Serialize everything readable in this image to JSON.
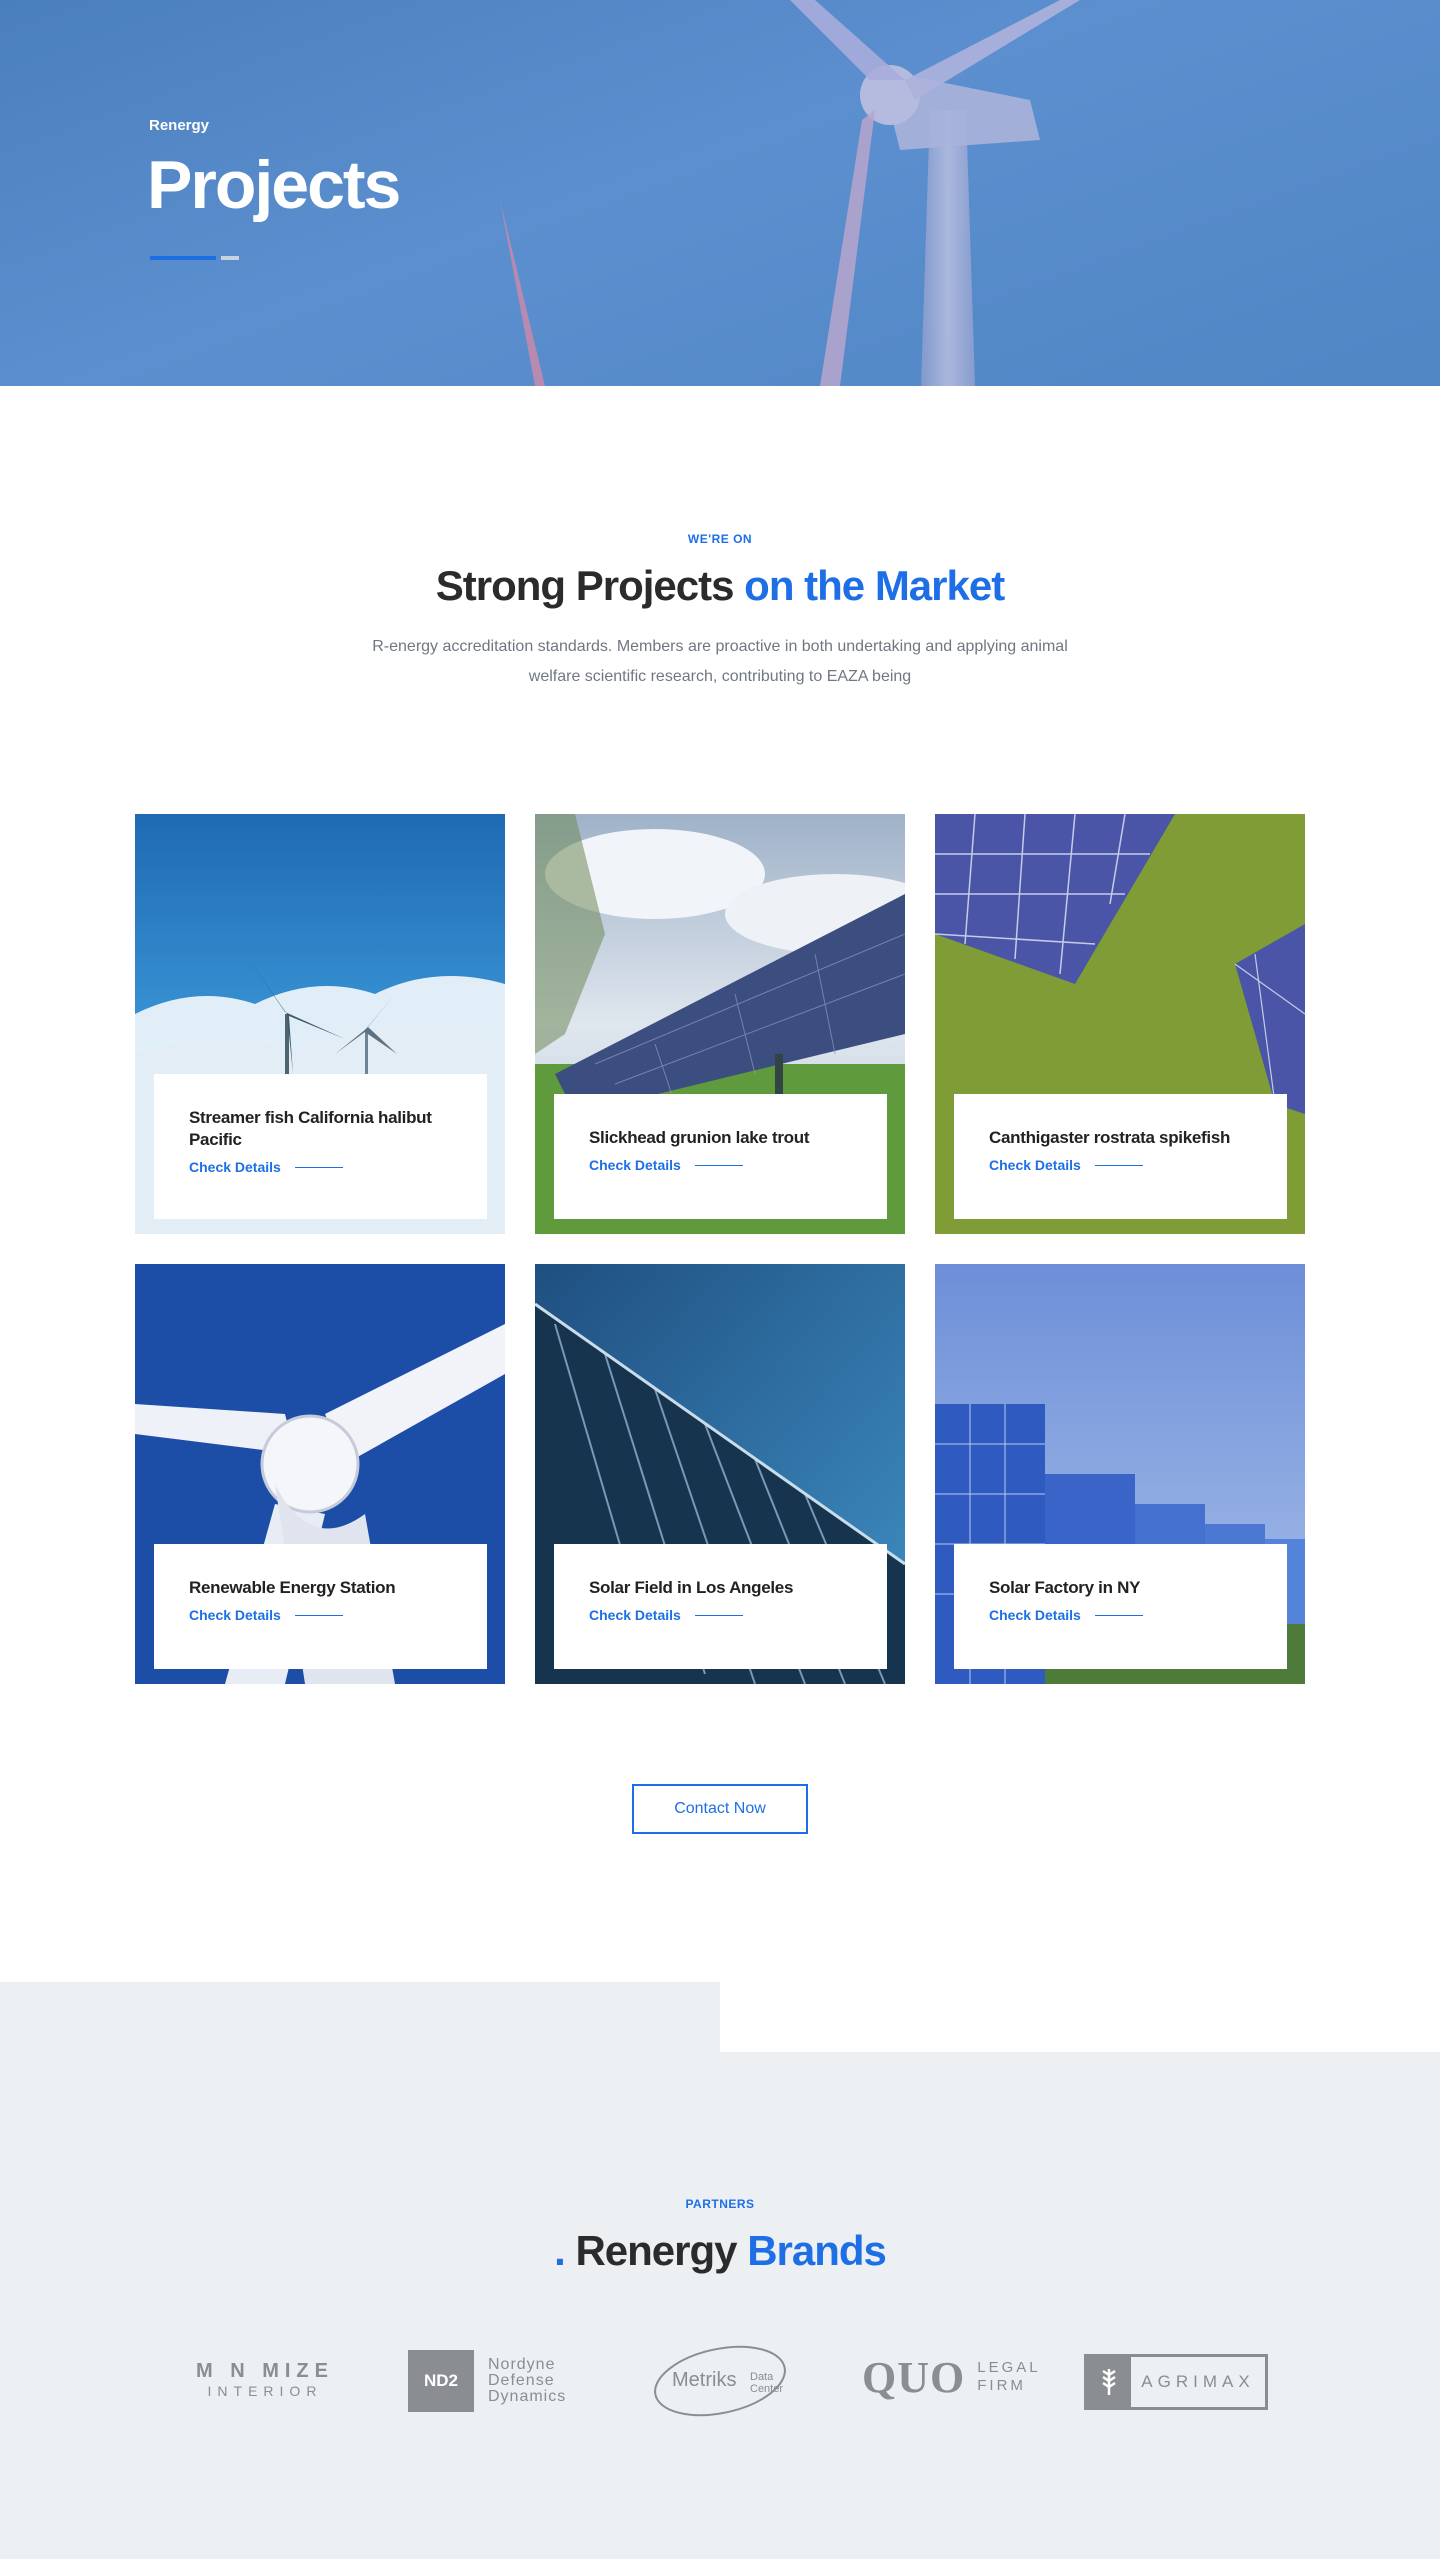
{
  "hero": {
    "breadcrumb": "Renergy",
    "title": "Projects"
  },
  "intro": {
    "eyebrow": "WE'RE ON",
    "title_main": "Strong Projects",
    "title_accent": "on the Market",
    "lead": "R-energy accreditation standards. Members are proactive in both undertaking and applying animal welfare scientific research, contributing to EAZA being"
  },
  "projects": [
    {
      "name": "Streamer fish California halibut Pacific",
      "link": "Check Details",
      "image": "wind-turbines-clouds"
    },
    {
      "name": "Slickhead grunion lake trout",
      "link": "Check Details",
      "image": "solar-panels-field"
    },
    {
      "name": "Canthigaster rostrata spikefish",
      "link": "Check Details",
      "image": "solar-panels-grass"
    },
    {
      "name": "Renewable Energy Station",
      "link": "Check Details",
      "image": "wind-turbine-hub"
    },
    {
      "name": "Solar Field in Los Angeles",
      "link": "Check Details",
      "image": "solar-panel-underside"
    },
    {
      "name": "Solar Factory in NY",
      "link": "Check Details",
      "image": "solar-panel-rows"
    }
  ],
  "cta": {
    "label": "Contact Now"
  },
  "partners": {
    "eyebrow": "PARTNERS",
    "title_prefix": ".",
    "title_main": "Renergy",
    "title_accent": "Brands",
    "logos": [
      {
        "line1": "M N MIZE",
        "line2": "INTERIOR"
      },
      {
        "badge": "ND2",
        "line1": "Nordyne",
        "line2": "Defense",
        "line3": "Dynamics"
      },
      {
        "word": "Metriks",
        "sub1": "Data",
        "sub2": "Center"
      },
      {
        "word": "QUO",
        "sub1": "LEGAL",
        "sub2": "FIRM"
      },
      {
        "word": "AGRIMAX"
      }
    ]
  },
  "colors": {
    "accent": "#1e6fe6",
    "heading": "#2b2b2b",
    "muted": "#707782",
    "partners_bg": "#edf0f3"
  }
}
